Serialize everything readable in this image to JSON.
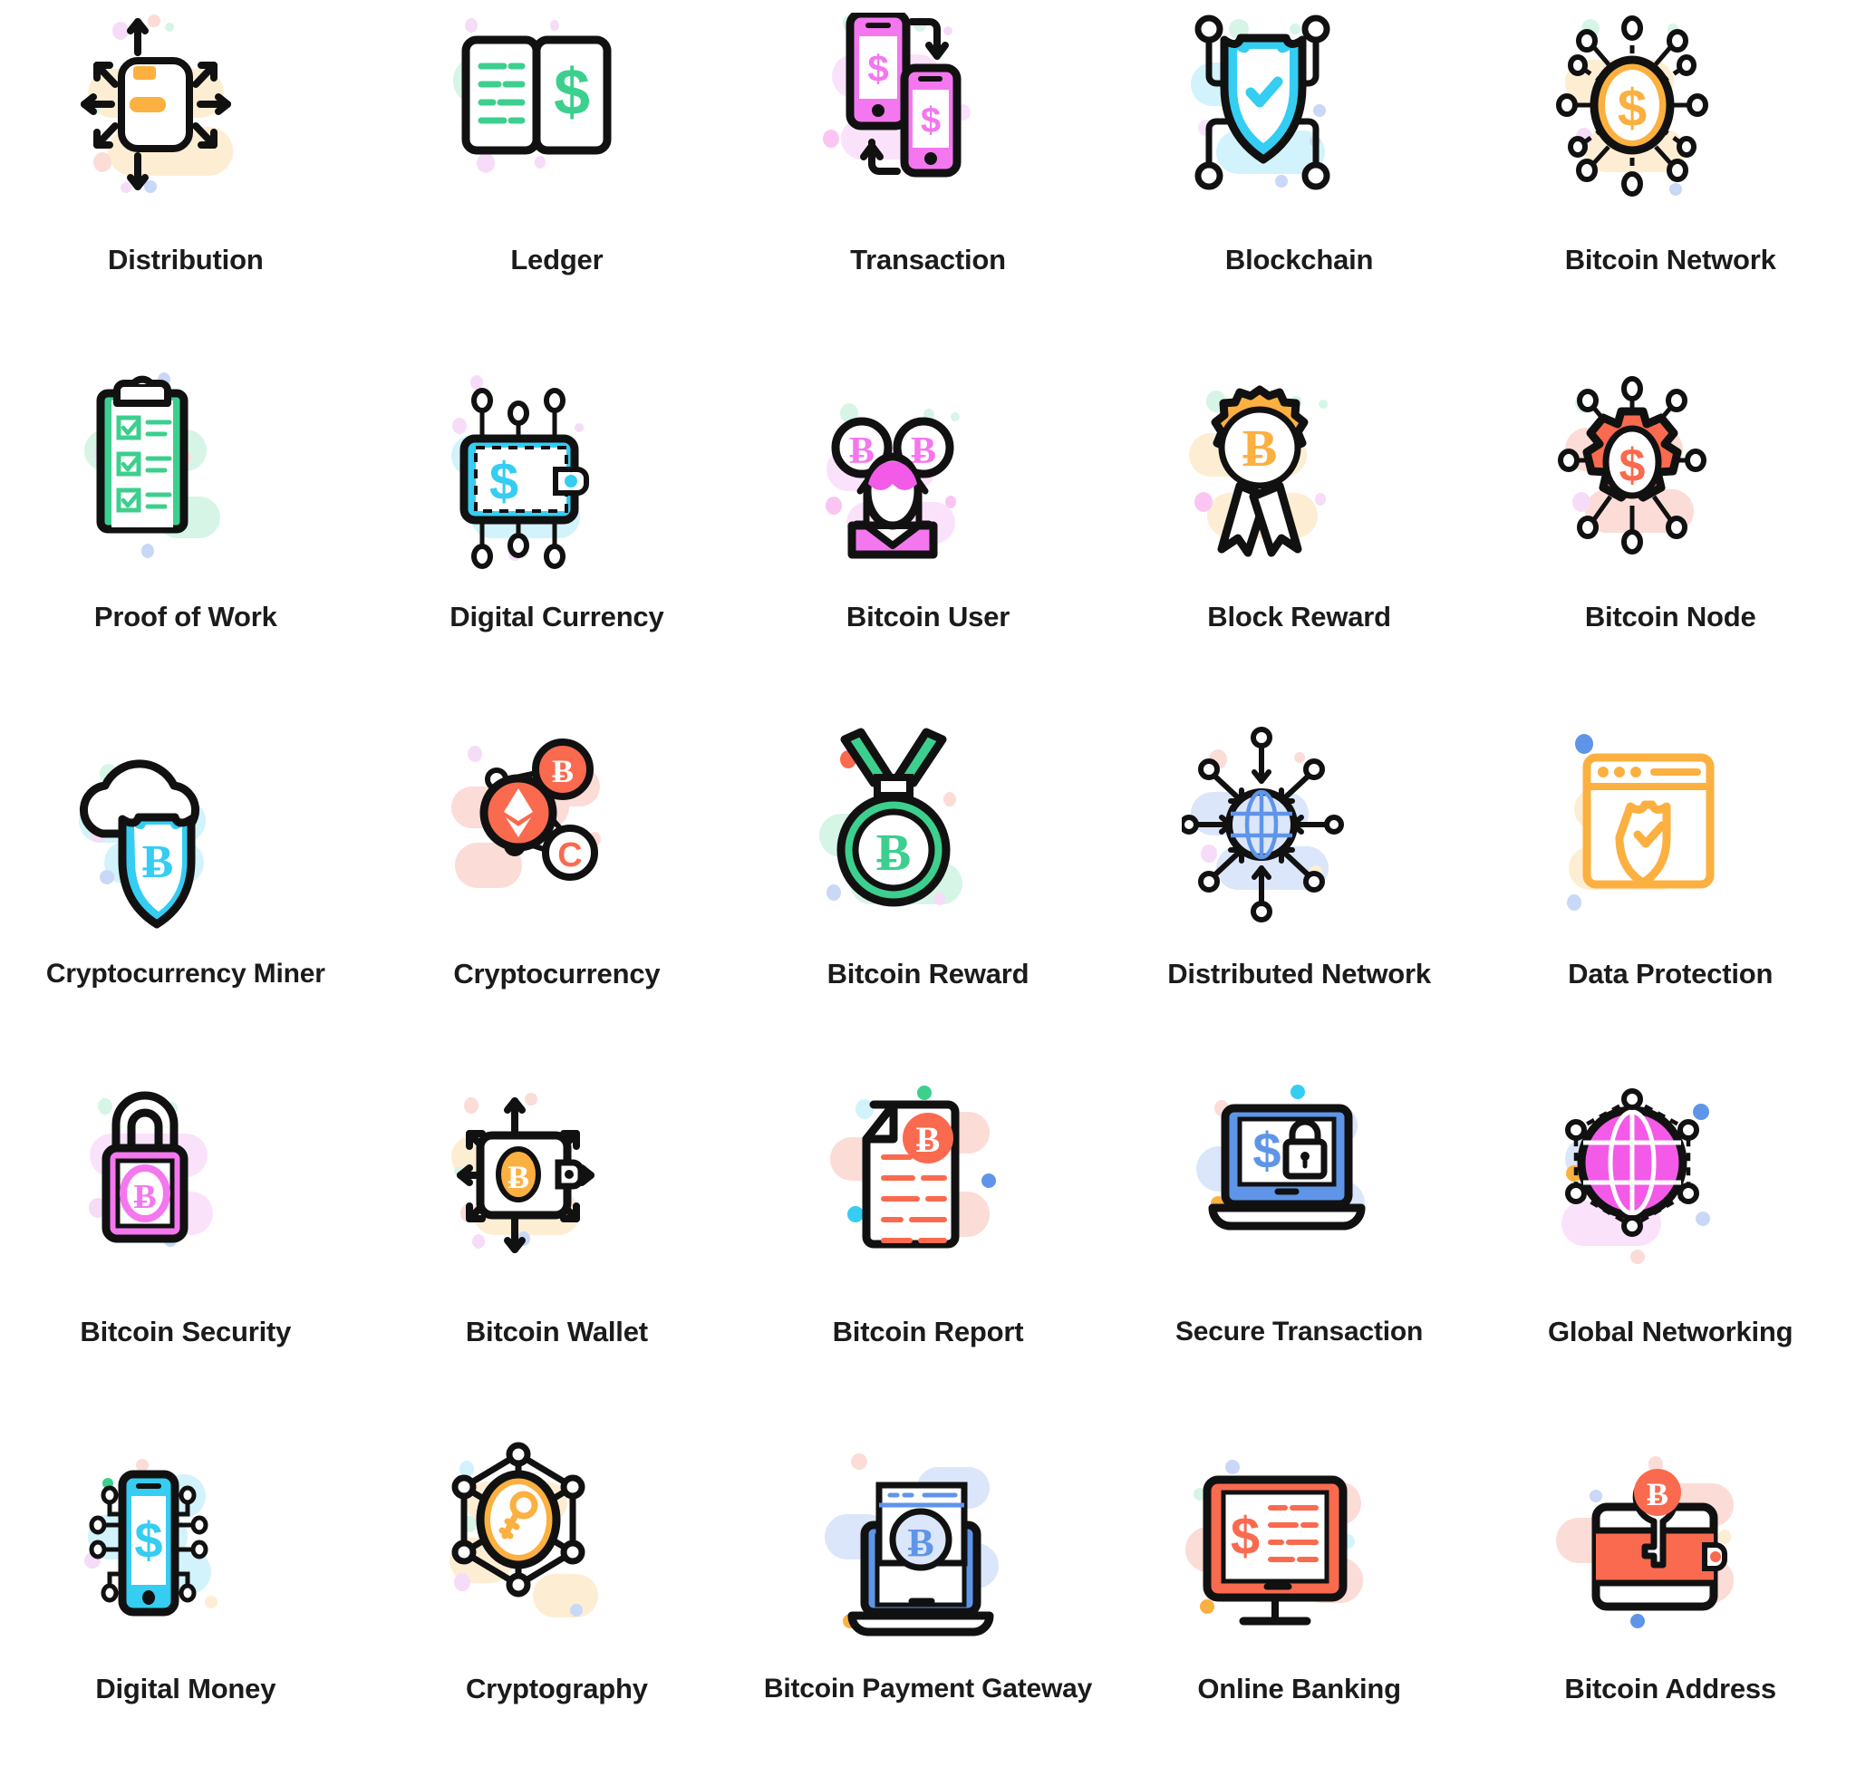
{
  "sheet": {
    "columns": 5,
    "rows": 5,
    "background": "#ffffff",
    "label_color": "#1b1b1b"
  },
  "palette": {
    "outline": "#111111",
    "green": "#3ccf8e",
    "green_soft": "#d6f5e6",
    "cyan": "#35cdf2",
    "cyan_soft": "#d2f3fb",
    "pink": "#f477ef",
    "pink_soft": "#fbe2fb",
    "magenta": "#f45ae8",
    "orange": "#fbb040",
    "orange_soft": "#fdeed3",
    "red": "#fa6a4f",
    "red_soft": "#fbdcd6",
    "blue": "#5f95e8",
    "blue_soft": "#dbe6fa",
    "white": "#ffffff"
  },
  "icons": [
    {
      "label": "Distribution",
      "name": "distribution",
      "accent": "#fbb040",
      "blob": "#fdeed3"
    },
    {
      "label": "Ledger",
      "name": "ledger",
      "accent": "#3ccf8e",
      "blob": "#d6f5e6"
    },
    {
      "label": "Transaction",
      "name": "transaction",
      "accent": "#f477ef",
      "blob": "#fbe2fb"
    },
    {
      "label": "Blockchain",
      "name": "blockchain",
      "accent": "#35cdf2",
      "blob": "#d2f3fb"
    },
    {
      "label": "Bitcoin Network",
      "name": "bitcoin-network",
      "accent": "#fbb040",
      "blob": "#fdeed3"
    },
    {
      "label": "Proof of  Work",
      "name": "proof-of-work",
      "accent": "#3ccf8e",
      "blob": "#d6f5e6"
    },
    {
      "label": "Digital Currency",
      "name": "digital-currency",
      "accent": "#35cdf2",
      "blob": "#d2f3fb"
    },
    {
      "label": "Bitcoin User",
      "name": "bitcoin-user",
      "accent": "#f477ef",
      "blob": "#fbe2fb"
    },
    {
      "label": "Block Reward",
      "name": "block-reward",
      "accent": "#fbb040",
      "blob": "#fdeed3"
    },
    {
      "label": "Bitcoin Node",
      "name": "bitcoin-node",
      "accent": "#fa6a4f",
      "blob": "#fbdcd6"
    },
    {
      "label": "Cryptocurrency Miner",
      "name": "cryptocurrency-miner",
      "accent": "#35cdf2",
      "blob": "#d2f3fb"
    },
    {
      "label": "Cryptocurrency",
      "name": "cryptocurrency",
      "accent": "#fa6a4f",
      "blob": "#fbdcd6"
    },
    {
      "label": "Bitcoin Reward",
      "name": "bitcoin-reward",
      "accent": "#3ccf8e",
      "blob": "#d6f5e6"
    },
    {
      "label": "Distributed Network",
      "name": "distributed-network",
      "accent": "#5f95e8",
      "blob": "#dbe6fa"
    },
    {
      "label": "Data Protection",
      "name": "data-protection",
      "accent": "#fbb040",
      "blob": "#fdeed3"
    },
    {
      "label": "Bitcoin Security",
      "name": "bitcoin-security",
      "accent": "#f477ef",
      "blob": "#fbe2fb"
    },
    {
      "label": "Bitcoin Wallet",
      "name": "bitcoin-wallet",
      "accent": "#fbb040",
      "blob": "#fdeed3"
    },
    {
      "label": "Bitcoin Report",
      "name": "bitcoin-report",
      "accent": "#fa6a4f",
      "blob": "#fbdcd6"
    },
    {
      "label": "Secure Transaction",
      "name": "secure-transaction",
      "accent": "#5f95e8",
      "blob": "#dbe6fa"
    },
    {
      "label": "Global Networking",
      "name": "global-networking",
      "accent": "#f45ae8",
      "blob": "#fbe2fb"
    },
    {
      "label": "Digital Money",
      "name": "digital-money",
      "accent": "#35cdf2",
      "blob": "#d2f3fb"
    },
    {
      "label": "Cryptography",
      "name": "cryptography",
      "accent": "#fbb040",
      "blob": "#fdeed3"
    },
    {
      "label": "Bitcoin Payment Gateway",
      "name": "bitcoin-payment-gateway",
      "accent": "#5f95e8",
      "blob": "#dbe6fa"
    },
    {
      "label": "Online Banking",
      "name": "online-banking",
      "accent": "#fa6a4f",
      "blob": "#fbdcd6"
    },
    {
      "label": "Bitcoin Address",
      "name": "bitcoin-address",
      "accent": "#fa6a4f",
      "blob": "#fbdcd6"
    }
  ],
  "symbols": {
    "bitcoin": "Ƀ",
    "dollar": "$",
    "ethereum": "♦",
    "coin_c": "C",
    "check": "✓"
  }
}
